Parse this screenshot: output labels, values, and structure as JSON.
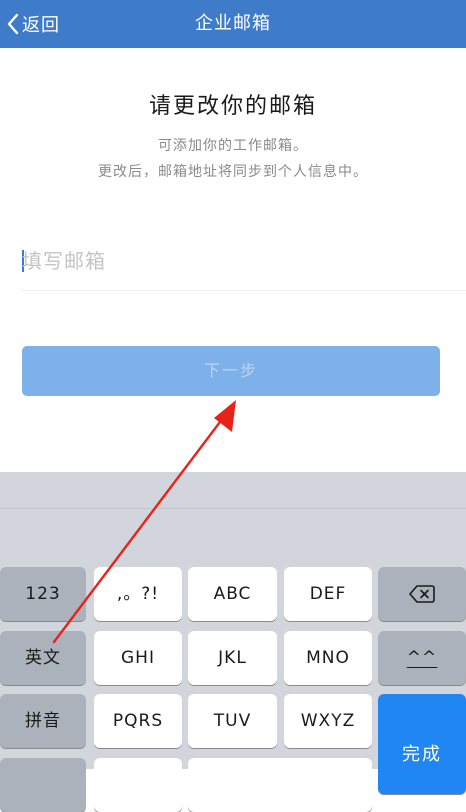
{
  "navbar": {
    "back_label": "返回",
    "title": "企业邮箱",
    "color": "#3e7bc9"
  },
  "content": {
    "title": "请更改你的邮箱",
    "subtitle_line1": "可添加你的工作邮箱。",
    "subtitle_line2": "更改后，邮箱地址将同步到个人信息中。",
    "email_placeholder": "填写邮箱",
    "email_value": "",
    "next_button_label": "下一步",
    "button_color": "#7eb0ea"
  },
  "keyboard": {
    "rows": [
      [
        "123",
        ",。?!",
        "ABC",
        "DEF"
      ],
      [
        "英文",
        "GHI",
        "JKL",
        "MNO"
      ],
      [
        "拼音",
        "PQRS",
        "TUV",
        "WXYZ"
      ]
    ],
    "delete_icon": "backspace-icon",
    "emoticon_label": "^^",
    "done_label": "完成",
    "done_color": "#1f86f4"
  },
  "annotation": {
    "arrow_color": "#e8221b"
  }
}
